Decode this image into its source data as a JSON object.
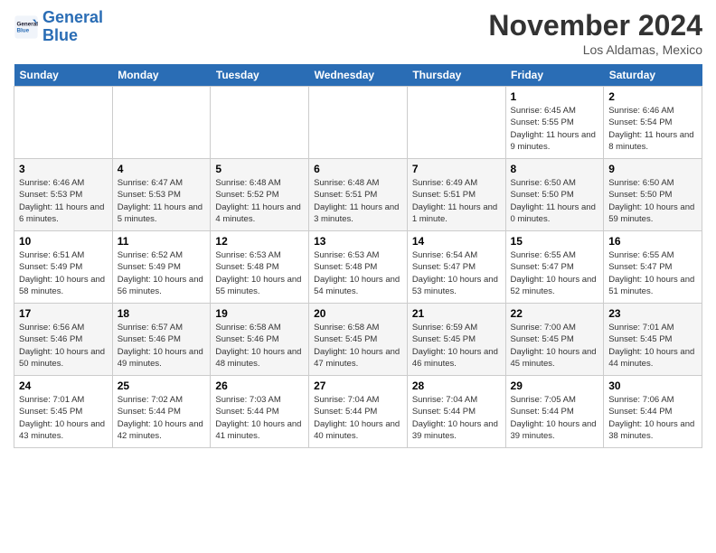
{
  "logo": {
    "line1": "General",
    "line2": "Blue"
  },
  "title": "November 2024",
  "location": "Los Aldamas, Mexico",
  "days_of_week": [
    "Sunday",
    "Monday",
    "Tuesday",
    "Wednesday",
    "Thursday",
    "Friday",
    "Saturday"
  ],
  "weeks": [
    [
      {
        "day": "",
        "sunrise": "",
        "sunset": "",
        "daylight": ""
      },
      {
        "day": "",
        "sunrise": "",
        "sunset": "",
        "daylight": ""
      },
      {
        "day": "",
        "sunrise": "",
        "sunset": "",
        "daylight": ""
      },
      {
        "day": "",
        "sunrise": "",
        "sunset": "",
        "daylight": ""
      },
      {
        "day": "",
        "sunrise": "",
        "sunset": "",
        "daylight": ""
      },
      {
        "day": "1",
        "sunrise": "Sunrise: 6:45 AM",
        "sunset": "Sunset: 5:55 PM",
        "daylight": "Daylight: 11 hours and 9 minutes."
      },
      {
        "day": "2",
        "sunrise": "Sunrise: 6:46 AM",
        "sunset": "Sunset: 5:54 PM",
        "daylight": "Daylight: 11 hours and 8 minutes."
      }
    ],
    [
      {
        "day": "3",
        "sunrise": "Sunrise: 6:46 AM",
        "sunset": "Sunset: 5:53 PM",
        "daylight": "Daylight: 11 hours and 6 minutes."
      },
      {
        "day": "4",
        "sunrise": "Sunrise: 6:47 AM",
        "sunset": "Sunset: 5:53 PM",
        "daylight": "Daylight: 11 hours and 5 minutes."
      },
      {
        "day": "5",
        "sunrise": "Sunrise: 6:48 AM",
        "sunset": "Sunset: 5:52 PM",
        "daylight": "Daylight: 11 hours and 4 minutes."
      },
      {
        "day": "6",
        "sunrise": "Sunrise: 6:48 AM",
        "sunset": "Sunset: 5:51 PM",
        "daylight": "Daylight: 11 hours and 3 minutes."
      },
      {
        "day": "7",
        "sunrise": "Sunrise: 6:49 AM",
        "sunset": "Sunset: 5:51 PM",
        "daylight": "Daylight: 11 hours and 1 minute."
      },
      {
        "day": "8",
        "sunrise": "Sunrise: 6:50 AM",
        "sunset": "Sunset: 5:50 PM",
        "daylight": "Daylight: 11 hours and 0 minutes."
      },
      {
        "day": "9",
        "sunrise": "Sunrise: 6:50 AM",
        "sunset": "Sunset: 5:50 PM",
        "daylight": "Daylight: 10 hours and 59 minutes."
      }
    ],
    [
      {
        "day": "10",
        "sunrise": "Sunrise: 6:51 AM",
        "sunset": "Sunset: 5:49 PM",
        "daylight": "Daylight: 10 hours and 58 minutes."
      },
      {
        "day": "11",
        "sunrise": "Sunrise: 6:52 AM",
        "sunset": "Sunset: 5:49 PM",
        "daylight": "Daylight: 10 hours and 56 minutes."
      },
      {
        "day": "12",
        "sunrise": "Sunrise: 6:53 AM",
        "sunset": "Sunset: 5:48 PM",
        "daylight": "Daylight: 10 hours and 55 minutes."
      },
      {
        "day": "13",
        "sunrise": "Sunrise: 6:53 AM",
        "sunset": "Sunset: 5:48 PM",
        "daylight": "Daylight: 10 hours and 54 minutes."
      },
      {
        "day": "14",
        "sunrise": "Sunrise: 6:54 AM",
        "sunset": "Sunset: 5:47 PM",
        "daylight": "Daylight: 10 hours and 53 minutes."
      },
      {
        "day": "15",
        "sunrise": "Sunrise: 6:55 AM",
        "sunset": "Sunset: 5:47 PM",
        "daylight": "Daylight: 10 hours and 52 minutes."
      },
      {
        "day": "16",
        "sunrise": "Sunrise: 6:55 AM",
        "sunset": "Sunset: 5:47 PM",
        "daylight": "Daylight: 10 hours and 51 minutes."
      }
    ],
    [
      {
        "day": "17",
        "sunrise": "Sunrise: 6:56 AM",
        "sunset": "Sunset: 5:46 PM",
        "daylight": "Daylight: 10 hours and 50 minutes."
      },
      {
        "day": "18",
        "sunrise": "Sunrise: 6:57 AM",
        "sunset": "Sunset: 5:46 PM",
        "daylight": "Daylight: 10 hours and 49 minutes."
      },
      {
        "day": "19",
        "sunrise": "Sunrise: 6:58 AM",
        "sunset": "Sunset: 5:46 PM",
        "daylight": "Daylight: 10 hours and 48 minutes."
      },
      {
        "day": "20",
        "sunrise": "Sunrise: 6:58 AM",
        "sunset": "Sunset: 5:45 PM",
        "daylight": "Daylight: 10 hours and 47 minutes."
      },
      {
        "day": "21",
        "sunrise": "Sunrise: 6:59 AM",
        "sunset": "Sunset: 5:45 PM",
        "daylight": "Daylight: 10 hours and 46 minutes."
      },
      {
        "day": "22",
        "sunrise": "Sunrise: 7:00 AM",
        "sunset": "Sunset: 5:45 PM",
        "daylight": "Daylight: 10 hours and 45 minutes."
      },
      {
        "day": "23",
        "sunrise": "Sunrise: 7:01 AM",
        "sunset": "Sunset: 5:45 PM",
        "daylight": "Daylight: 10 hours and 44 minutes."
      }
    ],
    [
      {
        "day": "24",
        "sunrise": "Sunrise: 7:01 AM",
        "sunset": "Sunset: 5:45 PM",
        "daylight": "Daylight: 10 hours and 43 minutes."
      },
      {
        "day": "25",
        "sunrise": "Sunrise: 7:02 AM",
        "sunset": "Sunset: 5:44 PM",
        "daylight": "Daylight: 10 hours and 42 minutes."
      },
      {
        "day": "26",
        "sunrise": "Sunrise: 7:03 AM",
        "sunset": "Sunset: 5:44 PM",
        "daylight": "Daylight: 10 hours and 41 minutes."
      },
      {
        "day": "27",
        "sunrise": "Sunrise: 7:04 AM",
        "sunset": "Sunset: 5:44 PM",
        "daylight": "Daylight: 10 hours and 40 minutes."
      },
      {
        "day": "28",
        "sunrise": "Sunrise: 7:04 AM",
        "sunset": "Sunset: 5:44 PM",
        "daylight": "Daylight: 10 hours and 39 minutes."
      },
      {
        "day": "29",
        "sunrise": "Sunrise: 7:05 AM",
        "sunset": "Sunset: 5:44 PM",
        "daylight": "Daylight: 10 hours and 39 minutes."
      },
      {
        "day": "30",
        "sunrise": "Sunrise: 7:06 AM",
        "sunset": "Sunset: 5:44 PM",
        "daylight": "Daylight: 10 hours and 38 minutes."
      }
    ]
  ]
}
